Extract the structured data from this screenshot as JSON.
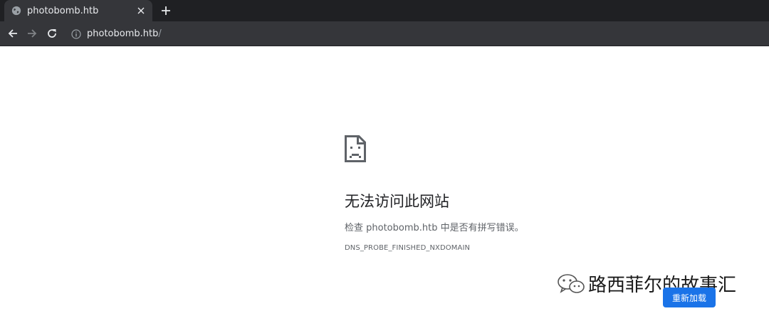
{
  "browser": {
    "tab": {
      "title": "photobomb.htb"
    },
    "address_bar": {
      "host": "photobomb.htb",
      "path": "/"
    }
  },
  "error_page": {
    "heading": "无法访问此网站",
    "suggestion": "检查 photobomb.htb 中是否有拼写错误。",
    "error_code": "DNS_PROBE_FINISHED_NXDOMAIN",
    "reload_label": "重新加载"
  },
  "watermark": {
    "text": "路西菲尔的故事汇"
  },
  "icons": {
    "favicon": "globe-icon",
    "tab_close": "close-icon",
    "new_tab": "plus-icon",
    "back": "arrow-left-icon",
    "forward": "arrow-right-icon",
    "reload": "reload-icon",
    "site_info": "info-icon",
    "error": "sad-page-icon"
  },
  "colors": {
    "chrome_dark": "#1f2023",
    "toolbar": "#35363a",
    "button_blue": "#1a73e8"
  }
}
